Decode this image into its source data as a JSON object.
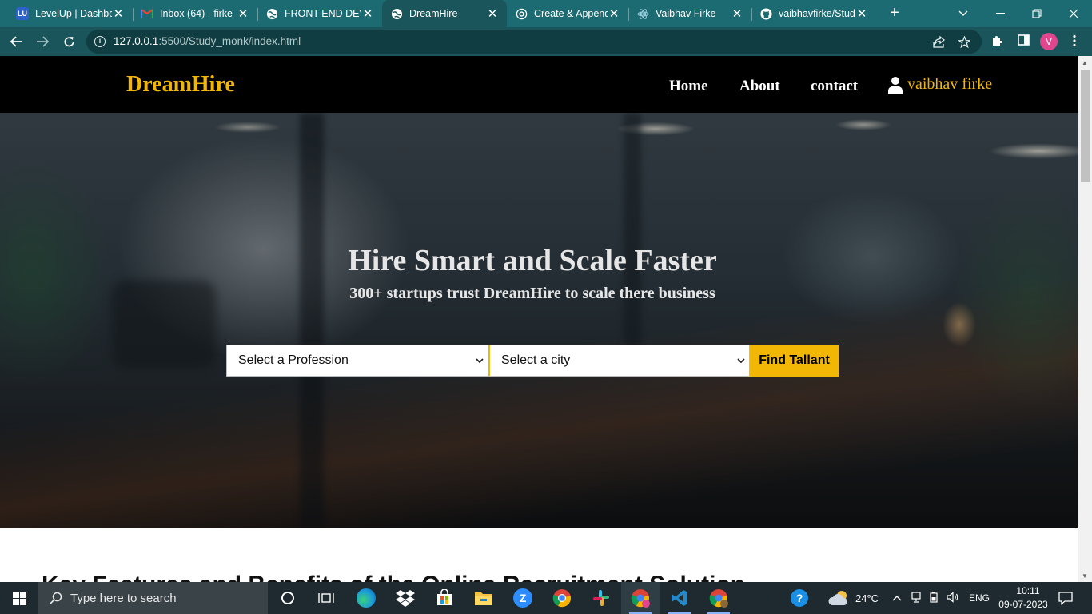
{
  "browser": {
    "tabs": [
      {
        "label": "LevelUp | Dashbo",
        "icon": "levelup-icon",
        "badge": "LU"
      },
      {
        "label": "Inbox (64) - firke",
        "icon": "gmail-icon",
        "badge": "M"
      },
      {
        "label": "FRONT END DEV",
        "icon": "globe-icon",
        "badge": ""
      },
      {
        "label": "DreamHire",
        "icon": "globe-icon",
        "badge": "",
        "active": true
      },
      {
        "label": "Create & Append",
        "icon": "openai-icon",
        "badge": ""
      },
      {
        "label": "Vaibhav Firke",
        "icon": "react-icon",
        "badge": ""
      },
      {
        "label": "vaibhavfirke/Stud",
        "icon": "github-icon",
        "badge": ""
      }
    ],
    "url_host": "127.0.0.1",
    "url_rest": ":5500/Study_monk/index.html",
    "profile_initial": "V"
  },
  "site": {
    "brand": "DreamHire",
    "nav": {
      "home": "Home",
      "about": "About",
      "contact": "contact",
      "user": "vaibhav firke"
    },
    "hero": {
      "title": "Hire Smart and Scale Faster",
      "subtitle": "300+ startups trust DreamHire to scale there business",
      "profession_placeholder": "Select a Profession",
      "city_placeholder": "Select a city",
      "button": "Find Tallant"
    },
    "section_heading": "Key Features and Benefits of the Online Recruitment Solution"
  },
  "taskbar": {
    "search_placeholder": "Type here to search",
    "weather": "24°C",
    "language": "ENG",
    "time": "10:11",
    "date": "09-07-2023"
  },
  "colors": {
    "accent": "#f2b705",
    "chrome": "#19555b",
    "nav_bg": "#000000"
  }
}
